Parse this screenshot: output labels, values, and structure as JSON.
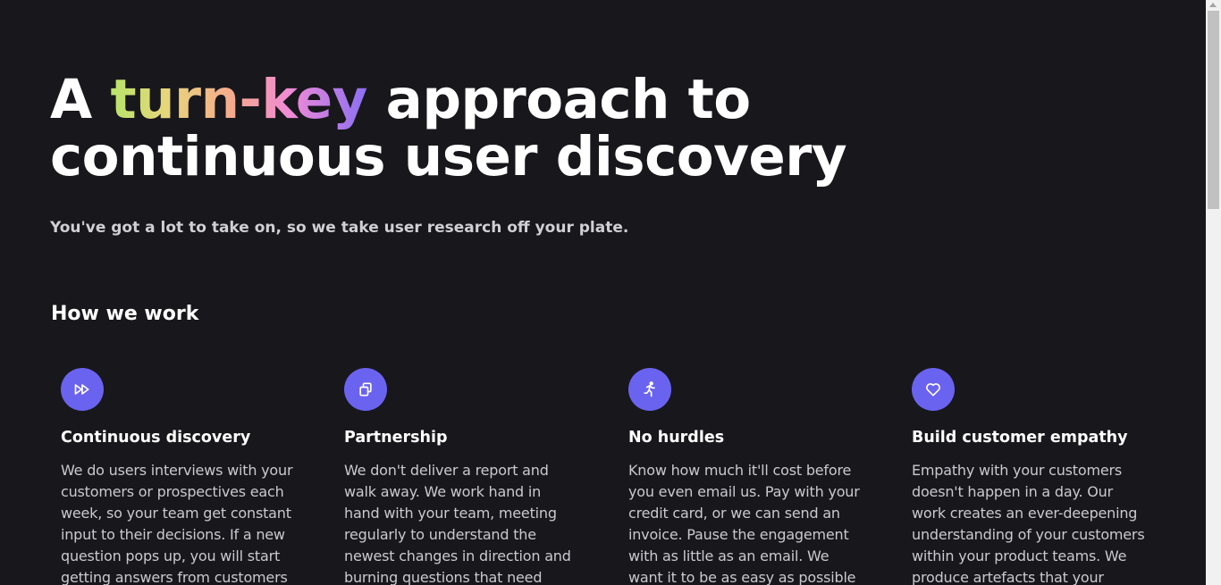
{
  "hero": {
    "title_prefix": "A ",
    "title_highlight": "turn-key",
    "title_rest": " approach to",
    "title_line2": "continuous user discovery",
    "subtitle": "You've got a lot to take on, so we take user research off your plate."
  },
  "section": {
    "title": "How we work"
  },
  "cards": [
    {
      "icon": "fast-forward-icon",
      "title": "Continuous discovery",
      "text": "We do users interviews with your customers or prospectives each week, so your team get constant input to their decisions. If a new question pops up, you will start getting answers from customers"
    },
    {
      "icon": "copy-icon",
      "title": "Partnership",
      "text": "We don't deliver a report and walk away. We work hand in hand with your team, meeting regularly to understand the newest changes in direction and burning questions that need"
    },
    {
      "icon": "running-person-icon",
      "title": "No hurdles",
      "text": "Know how much it'll cost before you even email us. Pay with your credit card, or we can send an invoice. Pause the engagement with as little as an email. We want it to be as easy as possible to"
    },
    {
      "icon": "heart-icon",
      "title": "Build customer empathy",
      "text": "Empathy with your customers doesn't happen in a day. Our work creates an ever-deepening understanding of your customers within your product teams. We produce artefacts that your"
    }
  ],
  "colors": {
    "background": "#18171c",
    "accent": "#6a63f0",
    "body_text": "#c9c9ce"
  }
}
